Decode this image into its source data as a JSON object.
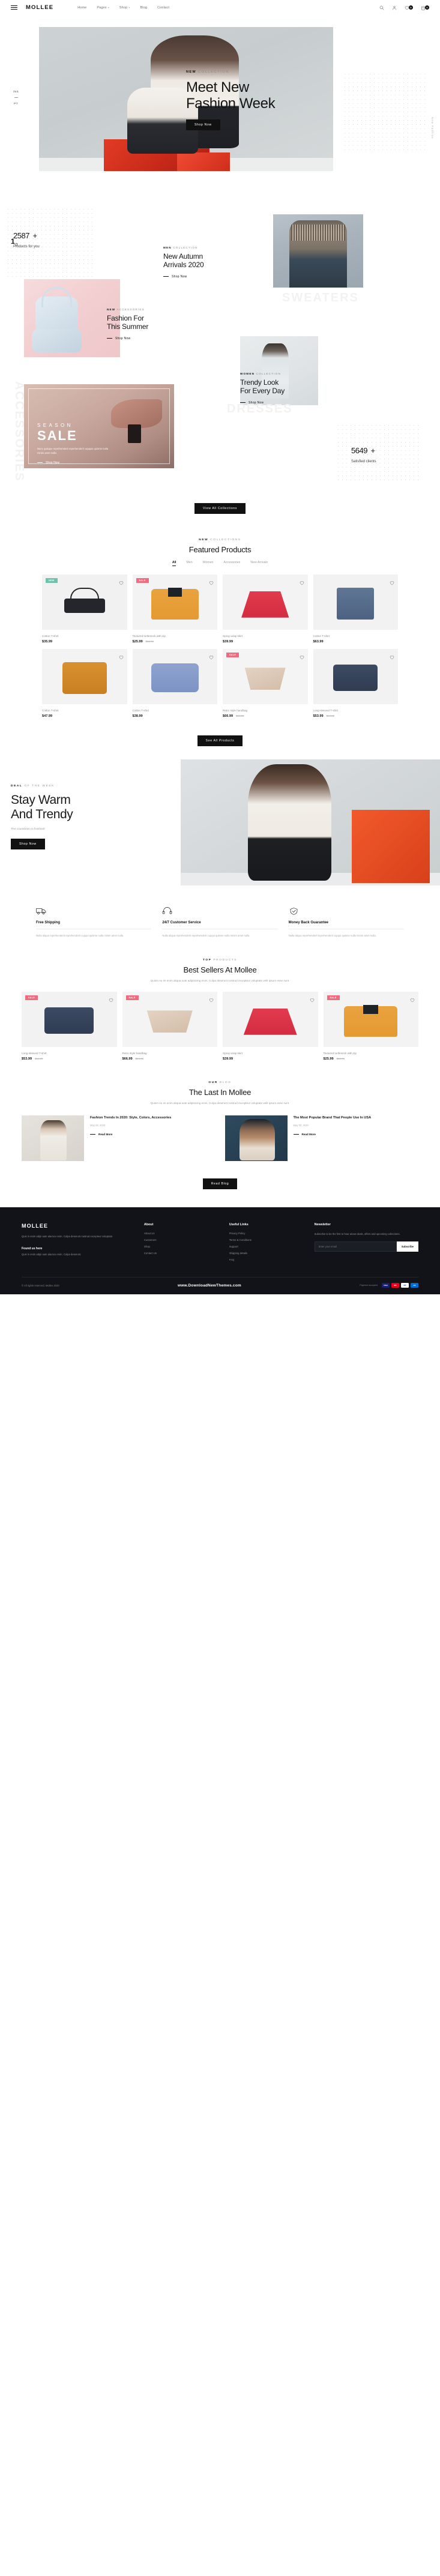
{
  "header": {
    "logo": "MOLLEE",
    "nav": [
      {
        "label": "Home",
        "caret": false
      },
      {
        "label": "Pages",
        "caret": true
      },
      {
        "label": "Shop",
        "caret": true
      },
      {
        "label": "Blog",
        "caret": false
      },
      {
        "label": "Contact",
        "caret": false
      }
    ],
    "wishlist_count": "0",
    "cart_count": "0"
  },
  "hero": {
    "kicker_bold": "NEW",
    "kicker_rest": " COLLECTION",
    "title_line1": "Meet New",
    "title_line2": "Fashion Week",
    "button": "Shop Now",
    "social": [
      "INS",
      "PT"
    ],
    "slide_current": "1",
    "slide_total": "/3",
    "side_label": "New Fashion"
  },
  "stats": {
    "products_number": "2587",
    "products_plus": "+",
    "products_label": "Products for you",
    "clients_number": "5649",
    "clients_plus": "+",
    "clients_label": "Satisfied clients"
  },
  "categories": {
    "men": {
      "kick_bold": "MEN",
      "kick_rest": " COLLECTION",
      "title_line1": "New Autumn",
      "title_line2": "Arrivals 2020",
      "cta": "Shop Now",
      "ghost": "SWEATERS"
    },
    "accessories": {
      "kick_bold": "NEW",
      "kick_rest": " ACCESSORIES",
      "title_line1": "Fashion For",
      "title_line2": "This Summer",
      "cta": "Shop Now",
      "ghost": "ACCESSORIES"
    },
    "sale": {
      "line1": "SEASON",
      "line2": "SALE",
      "desc": "Nunc quisque reprehenderit reprehenderit cupquis quisme nulla minim amet nulla.",
      "cta": "Shop Now"
    },
    "women": {
      "kick_bold": "WOMEN",
      "kick_rest": " COLLECTION",
      "title_line1": "Trendy Look",
      "title_line2": "For Every Day",
      "cta": "Shop Now",
      "ghost": "DRESSES"
    },
    "view_all": "View All Collections"
  },
  "featured": {
    "kick_bold": "NEW",
    "kick_rest": " COLLECTIONS",
    "title": "Featured Products",
    "tabs": [
      {
        "label": "All",
        "active": true
      },
      {
        "label": "Men",
        "active": false
      },
      {
        "label": "Women",
        "active": false
      },
      {
        "label": "Accessories",
        "active": false
      },
      {
        "label": "New Arrivals",
        "active": false
      }
    ],
    "button": "See All Products",
    "products": [
      {
        "name": "Cotton T-shirt",
        "price": "$35.99",
        "old": "",
        "tag": "NEW",
        "tag_type": "new",
        "art": "pa-bag"
      },
      {
        "name": "Textured turtleneck with zip",
        "price": "$25.99",
        "old": "$52.99",
        "tag": "SALE",
        "tag_type": "sale",
        "art": "pa-polo"
      },
      {
        "name": "Spray wrap skirt",
        "price": "$39.99",
        "old": "",
        "tag": "",
        "tag_type": "",
        "art": "pa-skirt"
      },
      {
        "name": "Cotton T-shirt",
        "price": "$63.99",
        "old": "",
        "tag": "",
        "tag_type": "",
        "art": "pa-jeans"
      },
      {
        "name": "Cotton T-shirt",
        "price": "$47.99",
        "old": "",
        "tag": "",
        "tag_type": "",
        "art": "pa-shirt"
      },
      {
        "name": "Cotton T-shirt",
        "price": "$38.99",
        "old": "",
        "tag": "",
        "tag_type": "",
        "art": "pa-sweat"
      },
      {
        "name": "Retro style handbag",
        "price": "$66.99",
        "old": "$84.99",
        "tag": "SALE",
        "tag_type": "sale",
        "art": "pa-hb"
      },
      {
        "name": "Long-sleeved T-shirt",
        "price": "$53.99",
        "old": "$64.99",
        "tag": "",
        "tag_type": "",
        "art": "pa-tee"
      }
    ]
  },
  "deal": {
    "kick_bold": "DEAL",
    "kick_rest": " OF THE WEEK",
    "title_line1": "Stay Warm",
    "title_line2": "And Trendy",
    "subtitle": "The countdown is finished!",
    "button": "Shop Now"
  },
  "features": [
    {
      "icon": "truck-icon",
      "title": "Free Shipping",
      "text": "Nulla aliqua reprehenderit reprehenderit cupqui quisme nulla minim amet nulla."
    },
    {
      "icon": "headset-icon",
      "title": "24/7 Customer Service",
      "text": "Nulla aliqua reprehenderit reprehenderit cupqui quisme nulla minim amet nulla."
    },
    {
      "icon": "shield-icon",
      "title": "Money Back Guarantee",
      "text": "Nulla aliqua reprehenderit reprehenderit cupqui quisme nulla minim amet nulla."
    }
  ],
  "best": {
    "kick_bold": "TOP",
    "kick_rest": " PRODUCTS",
    "title": "Best Sellers At Mollee",
    "desc": "Quism eu im enim aliqua aute adipisicing enim. Culpa deserunt nostrud excepteur voluptate velit ipsum esse sunt.",
    "products": [
      {
        "name": "Long-sleeved T-shirt",
        "price": "$53.99",
        "old": "$64.99",
        "tag": "SALE",
        "tag_type": "sale",
        "art": "pa-tee"
      },
      {
        "name": "Retro style handbag",
        "price": "$66.99",
        "old": "$84.99",
        "tag": "SALE",
        "tag_type": "sale",
        "art": "pa-hb"
      },
      {
        "name": "Spray wrap skirt",
        "price": "$39.99",
        "old": "",
        "tag": "",
        "tag_type": "",
        "art": "pa-skirt"
      },
      {
        "name": "Textured turtleneck with zip",
        "price": "$25.99",
        "old": "$52.99",
        "tag": "SALE",
        "tag_type": "sale",
        "art": "pa-polo"
      }
    ]
  },
  "blog": {
    "kick_bold": "OUR",
    "kick_rest": " BLOG",
    "title": "The Last In Mollee",
    "desc": "Quism eu im enim aliqua aute adipisicing enim. Culpa deserunt nostrud excepteur voluptate velit ipsum esse sunt.",
    "posts": [
      {
        "title": "Fashion Trends In 2020: Style, Colors, Accessories",
        "date": "May 03, 2020",
        "more": "Read More"
      },
      {
        "title": "The Most Popular Brand That People Use In USA",
        "date": "May 03, 2020",
        "more": "Read More"
      }
    ],
    "button": "Read Blog"
  },
  "footer": {
    "logo": "MOLLEE",
    "about_text": "Quis in enim adipi aute alamco enim. Culpa deserunt nostrud excepteur voluptate.",
    "found_title": "Found us here",
    "found_text": "Quis in enim adipi aute alamco enim. Culpa deserunt.",
    "columns": [
      {
        "title": "About",
        "links": [
          "About Us",
          "Customers",
          "Shop",
          "Contact Us"
        ]
      },
      {
        "title": "Useful Links",
        "links": [
          "Privacy Policy",
          "Terms & Conditions",
          "Support",
          "Shipping details",
          "FAQ"
        ]
      }
    ],
    "newsletter_title": "Newsletter",
    "newsletter_text": "Subscribe to be the first to hear about deals, offers and upcoming collections.",
    "newsletter_placeholder": "Enter your email",
    "newsletter_button": "Subscribe",
    "copyright": "© All rights reserved. Mollee 2020",
    "center_text": "www.DownloadNewThemes.com",
    "payments_label": "Payment accepted",
    "payments": [
      "VISA",
      "MC",
      "PP",
      "AE"
    ]
  }
}
